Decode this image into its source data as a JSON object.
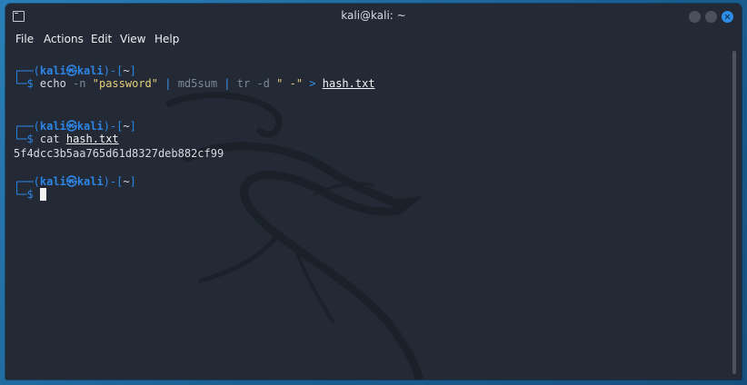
{
  "window": {
    "title": "kali@kali: ~"
  },
  "menu": [
    "File",
    "Actions",
    "Edit",
    "View",
    "Help"
  ],
  "prompt": {
    "user": "kali",
    "host": "kali",
    "dir": "~",
    "symbol": "$"
  },
  "commands": [
    {
      "cmd": "echo",
      "args": [
        {
          "text": "-n",
          "style": "gray"
        },
        {
          "text": "\"password\"",
          "style": "yellow"
        },
        {
          "text": "|",
          "style": "blue"
        },
        {
          "text": "md5sum",
          "style": "gray"
        },
        {
          "text": "|",
          "style": "blue"
        },
        {
          "text": "tr",
          "style": "gray"
        },
        {
          "text": "-d",
          "style": "gray"
        },
        {
          "text": "\" -\"",
          "style": "yellow"
        },
        {
          "text": ">",
          "style": "blue"
        },
        {
          "text": "hash.txt",
          "style": "underline"
        }
      ],
      "output": ""
    },
    {
      "cmd": "cat",
      "args": [
        {
          "text": "hash.txt",
          "style": "underline"
        }
      ],
      "output": "5f4dcc3b5aa765d61d8327deb882cf99"
    }
  ],
  "colors": {
    "prompt": "#2d86e6",
    "terminal_bg": "#232a35",
    "desktop": "#1f6a9e",
    "close_button": "#2d8ee8"
  }
}
